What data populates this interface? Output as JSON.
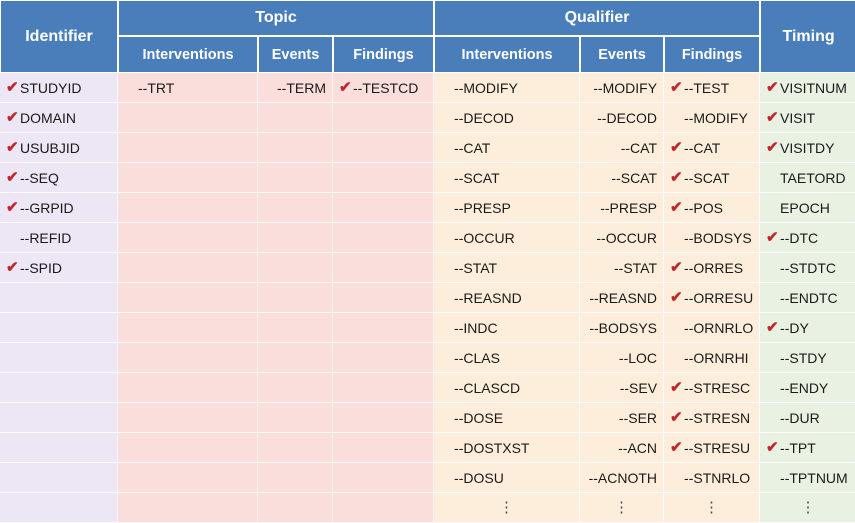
{
  "table": {
    "check_glyph": "✔",
    "ellipsis_glyph": "⋮",
    "colors": {
      "header_blue": "#4a7ebb",
      "identifier_bg": "#ece6f5",
      "topic_bg": "#fadedc",
      "qualifier_bg": "#fdeedc",
      "timing_bg": "#e9f2e2",
      "check_red": "#c0272d",
      "header_text": "#ffffff",
      "body_text": "#1a1a1a"
    },
    "header": {
      "groups": [
        {
          "label": "Identifier",
          "span": 1
        },
        {
          "label": "Topic",
          "span": 3
        },
        {
          "label": "Qualifier",
          "span": 3
        },
        {
          "label": "Timing",
          "span": 1
        }
      ],
      "subgroups": [
        "Interventions",
        "Events",
        "Findings",
        "Interventions",
        "Events",
        "Findings"
      ]
    },
    "columns": {
      "identifier": {
        "group": "Identifier",
        "name": "Identifier",
        "rows": [
          {
            "label": "STUDYID",
            "check": true
          },
          {
            "label": "DOMAIN",
            "check": true
          },
          {
            "label": "USUBJID",
            "check": true
          },
          {
            "label": "--SEQ",
            "check": true
          },
          {
            "label": "--GRPID",
            "check": true
          },
          {
            "label": "--REFID",
            "check": false
          },
          {
            "label": "--SPID",
            "check": true
          },
          {
            "label": "",
            "check": false
          },
          {
            "label": "",
            "check": false
          },
          {
            "label": "",
            "check": false
          },
          {
            "label": "",
            "check": false
          },
          {
            "label": "",
            "check": false
          },
          {
            "label": "",
            "check": false
          },
          {
            "label": "",
            "check": false
          },
          {
            "label": "",
            "check": false
          }
        ]
      },
      "topic_interventions": {
        "group": "Topic",
        "name": "Interventions",
        "rows": [
          {
            "label": "--TRT",
            "check": false
          },
          {
            "label": "",
            "check": false
          },
          {
            "label": "",
            "check": false
          },
          {
            "label": "",
            "check": false
          },
          {
            "label": "",
            "check": false
          },
          {
            "label": "",
            "check": false
          },
          {
            "label": "",
            "check": false
          },
          {
            "label": "",
            "check": false
          },
          {
            "label": "",
            "check": false
          },
          {
            "label": "",
            "check": false
          },
          {
            "label": "",
            "check": false
          },
          {
            "label": "",
            "check": false
          },
          {
            "label": "",
            "check": false
          },
          {
            "label": "",
            "check": false
          },
          {
            "label": "",
            "check": false
          }
        ]
      },
      "topic_events": {
        "group": "Topic",
        "name": "Events",
        "rows": [
          {
            "label": "--TERM",
            "check": false
          },
          {
            "label": "",
            "check": false
          },
          {
            "label": "",
            "check": false
          },
          {
            "label": "",
            "check": false
          },
          {
            "label": "",
            "check": false
          },
          {
            "label": "",
            "check": false
          },
          {
            "label": "",
            "check": false
          },
          {
            "label": "",
            "check": false
          },
          {
            "label": "",
            "check": false
          },
          {
            "label": "",
            "check": false
          },
          {
            "label": "",
            "check": false
          },
          {
            "label": "",
            "check": false
          },
          {
            "label": "",
            "check": false
          },
          {
            "label": "",
            "check": false
          },
          {
            "label": "",
            "check": false
          }
        ]
      },
      "topic_findings": {
        "group": "Topic",
        "name": "Findings",
        "rows": [
          {
            "label": "--TESTCD",
            "check": true
          },
          {
            "label": "",
            "check": false
          },
          {
            "label": "",
            "check": false
          },
          {
            "label": "",
            "check": false
          },
          {
            "label": "",
            "check": false
          },
          {
            "label": "",
            "check": false
          },
          {
            "label": "",
            "check": false
          },
          {
            "label": "",
            "check": false
          },
          {
            "label": "",
            "check": false
          },
          {
            "label": "",
            "check": false
          },
          {
            "label": "",
            "check": false
          },
          {
            "label": "",
            "check": false
          },
          {
            "label": "",
            "check": false
          },
          {
            "label": "",
            "check": false
          },
          {
            "label": "",
            "check": false
          }
        ]
      },
      "qualifier_interventions": {
        "group": "Qualifier",
        "name": "Interventions",
        "rows": [
          {
            "label": "--MODIFY",
            "check": false
          },
          {
            "label": "--DECOD",
            "check": false
          },
          {
            "label": "--CAT",
            "check": false
          },
          {
            "label": "--SCAT",
            "check": false
          },
          {
            "label": "--PRESP",
            "check": false
          },
          {
            "label": "--OCCUR",
            "check": false
          },
          {
            "label": "--STAT",
            "check": false
          },
          {
            "label": "--REASND",
            "check": false
          },
          {
            "label": "--INDC",
            "check": false
          },
          {
            "label": "--CLAS",
            "check": false
          },
          {
            "label": "--CLASCD",
            "check": false
          },
          {
            "label": "--DOSE",
            "check": false
          },
          {
            "label": "--DOSTXST",
            "check": false
          },
          {
            "label": "--DOSU",
            "check": false
          },
          {
            "label": "⋮",
            "check": false,
            "is_ellipsis": true
          }
        ]
      },
      "qualifier_events": {
        "group": "Qualifier",
        "name": "Events",
        "rows": [
          {
            "label": "--MODIFY",
            "check": false
          },
          {
            "label": "--DECOD",
            "check": false
          },
          {
            "label": "--CAT",
            "check": false
          },
          {
            "label": "--SCAT",
            "check": false
          },
          {
            "label": "--PRESP",
            "check": false
          },
          {
            "label": "--OCCUR",
            "check": false
          },
          {
            "label": "--STAT",
            "check": false
          },
          {
            "label": "--REASND",
            "check": false
          },
          {
            "label": "--BODSYS",
            "check": false
          },
          {
            "label": "--LOC",
            "check": false
          },
          {
            "label": "--SEV",
            "check": false
          },
          {
            "label": "--SER",
            "check": false
          },
          {
            "label": "--ACN",
            "check": false
          },
          {
            "label": "--ACNOTH",
            "check": false
          },
          {
            "label": "⋮",
            "check": false,
            "is_ellipsis": true
          }
        ]
      },
      "qualifier_findings": {
        "group": "Qualifier",
        "name": "Findings",
        "rows": [
          {
            "label": "--TEST",
            "check": true
          },
          {
            "label": "--MODIFY",
            "check": false
          },
          {
            "label": "--CAT",
            "check": true
          },
          {
            "label": "--SCAT",
            "check": true
          },
          {
            "label": "--POS",
            "check": true
          },
          {
            "label": "--BODSYS",
            "check": false
          },
          {
            "label": "--ORRES",
            "check": true
          },
          {
            "label": "--ORRESU",
            "check": true
          },
          {
            "label": "--ORNRLO",
            "check": false
          },
          {
            "label": "--ORNRHI",
            "check": false
          },
          {
            "label": "--STRESC",
            "check": true
          },
          {
            "label": "--STRESN",
            "check": true
          },
          {
            "label": "--STRESU",
            "check": true
          },
          {
            "label": "--STNRLO",
            "check": false
          },
          {
            "label": "⋮",
            "check": false,
            "is_ellipsis": true
          }
        ]
      },
      "timing": {
        "group": "Timing",
        "name": "Timing",
        "rows": [
          {
            "label": "VISITNUM",
            "check": true
          },
          {
            "label": "VISIT",
            "check": true
          },
          {
            "label": "VISITDY",
            "check": true
          },
          {
            "label": "TAETORD",
            "check": false
          },
          {
            "label": "EPOCH",
            "check": false
          },
          {
            "label": "--DTC",
            "check": true
          },
          {
            "label": "--STDTC",
            "check": false
          },
          {
            "label": "--ENDTC",
            "check": false
          },
          {
            "label": "--DY",
            "check": true
          },
          {
            "label": "--STDY",
            "check": false
          },
          {
            "label": "--ENDY",
            "check": false
          },
          {
            "label": "--DUR",
            "check": false
          },
          {
            "label": "--TPT",
            "check": true
          },
          {
            "label": "--TPTNUM",
            "check": false
          },
          {
            "label": "⋮",
            "check": false,
            "is_ellipsis": true
          }
        ]
      }
    }
  }
}
